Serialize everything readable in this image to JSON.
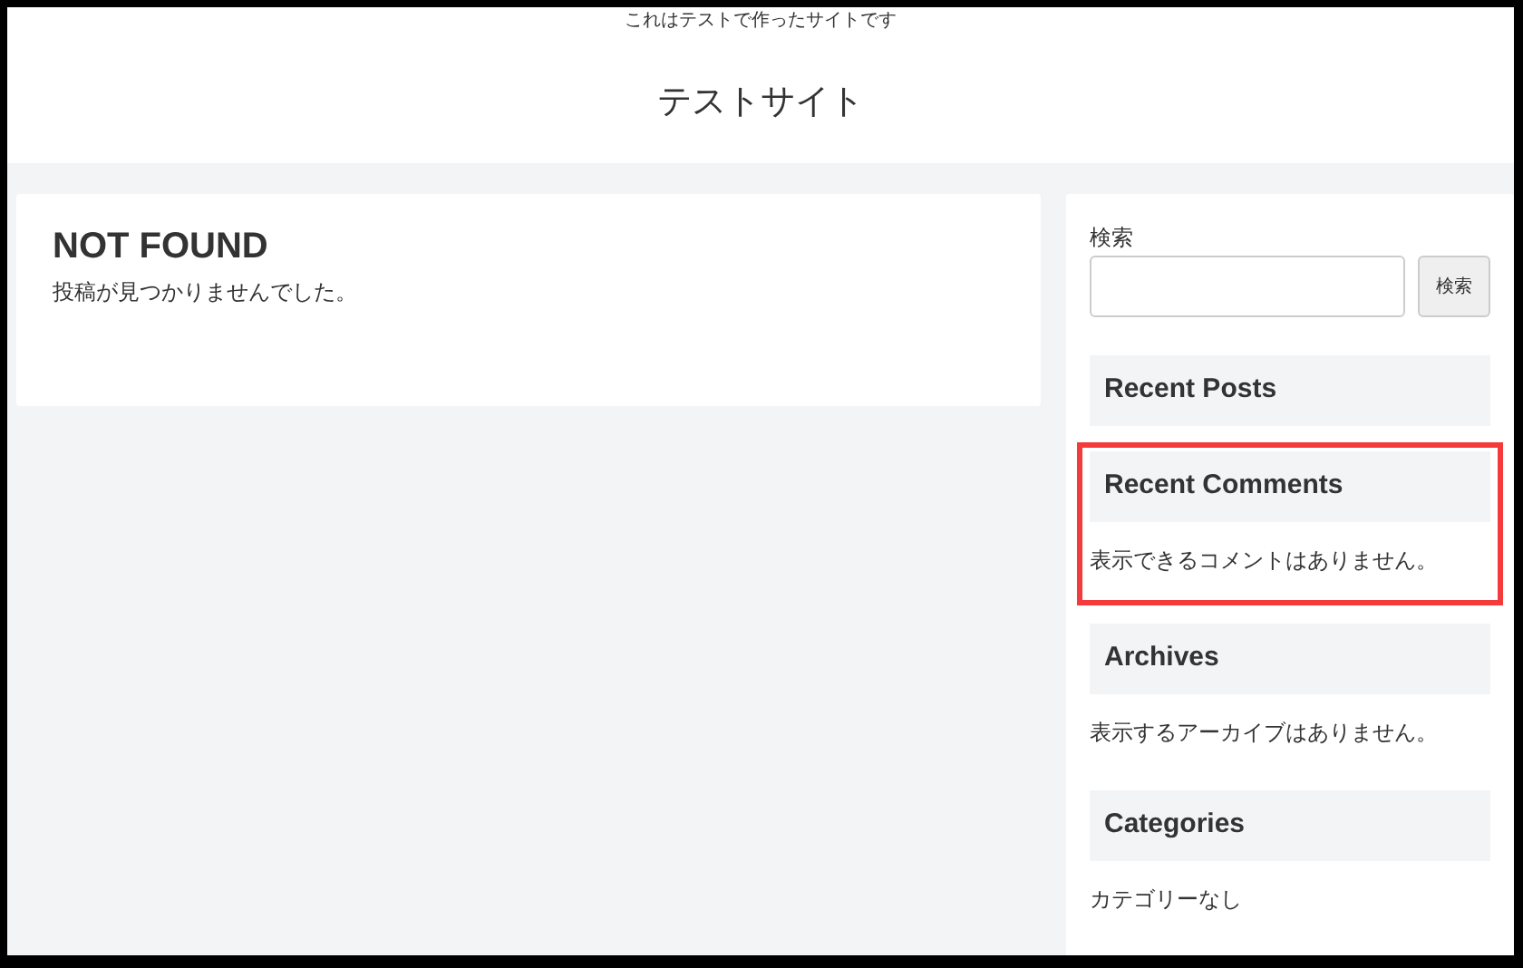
{
  "header": {
    "tagline": "これはテストで作ったサイトです",
    "site_title": "テストサイト"
  },
  "main": {
    "heading": "NOT FOUND",
    "message": "投稿が見つかりませんでした。"
  },
  "sidebar": {
    "search": {
      "label": "検索",
      "button": "検索"
    },
    "widgets": [
      {
        "title": "Recent Posts",
        "highlighted": false
      },
      {
        "title": "Recent Comments",
        "text": "表示できるコメントはありません。",
        "highlighted": true
      },
      {
        "title": "Archives",
        "text": "表示するアーカイブはありません。",
        "highlighted": false
      },
      {
        "title": "Categories",
        "text": "カテゴリーなし",
        "highlighted": false
      }
    ]
  }
}
